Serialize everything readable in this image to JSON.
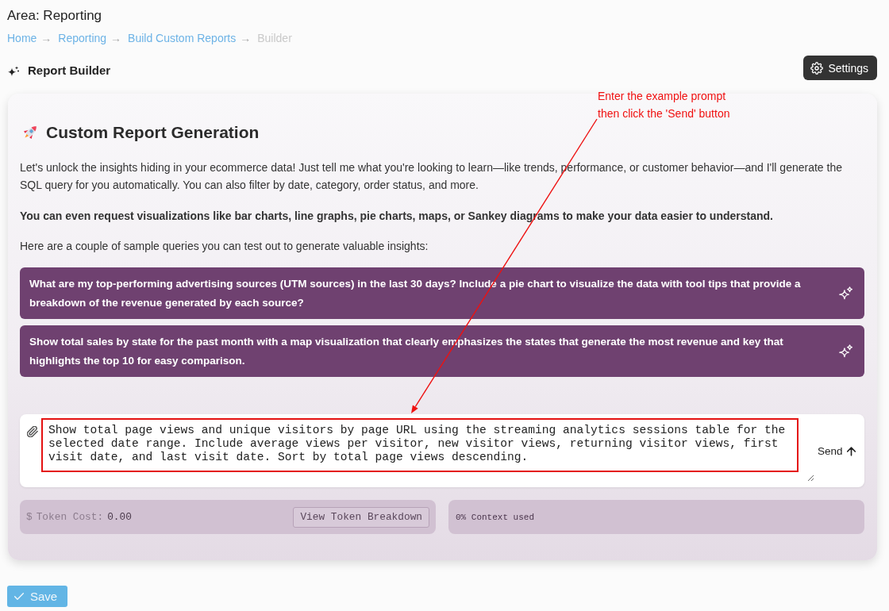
{
  "header": {
    "title": "Area: Reporting"
  },
  "breadcrumb": [
    {
      "label": "Home",
      "current": false,
      "separator": "→"
    },
    {
      "label": "Reporting",
      "current": false,
      "separator": "→"
    },
    {
      "label": "Build Custom Reports",
      "current": false,
      "separator": "→"
    },
    {
      "label": "Builder",
      "current": true
    }
  ],
  "toolbar": {
    "title": "Report Builder",
    "settings_button": "Settings"
  },
  "card": {
    "heading": "Custom Report Generation",
    "intro": "Let's unlock the insights hiding in your ecommerce data! Just tell me what you're looking to learn—like trends, performance, or customer behavior—and I'll generate the SQL query for you automatically. You can also filter by date, category, order status, and more.",
    "highlight": "You can even request visualizations like bar charts, line graphs, pie charts, maps, or Sankey diagrams to make your data easier to understand.",
    "samples_intro": "Here are a couple of sample queries you can test out to generate valuable insights:",
    "sample_queries": [
      "What are my top-performing advertising sources (UTM sources) in the last 30 days? Include a pie chart to visualize the data with tool tips that provide a breakdown of the revenue generated by each source?",
      "Show total sales by state for the past month with a map visualization that clearly emphasizes the states that generate the most revenue and key that highlights the top 10 for easy comparison."
    ]
  },
  "composer": {
    "value": "Show total page views and unique visitors by page URL using the streaming analytics sessions table for the selected date range. Include average views per visitor, new visitor views, returning visitor views, first visit date, and last visit date. Sort by total page views descending.",
    "send_button": "Send"
  },
  "token_bar": {
    "currency_symbol": "$",
    "cost_label": "Token Cost:",
    "cost_value": "0.00",
    "breakdown_button": "View Token Breakdown",
    "context": "0% Context used"
  },
  "save_button": "Save",
  "annotation": {
    "lines": [
      "Enter the example prompt",
      "then click the 'Send' button"
    ]
  }
}
